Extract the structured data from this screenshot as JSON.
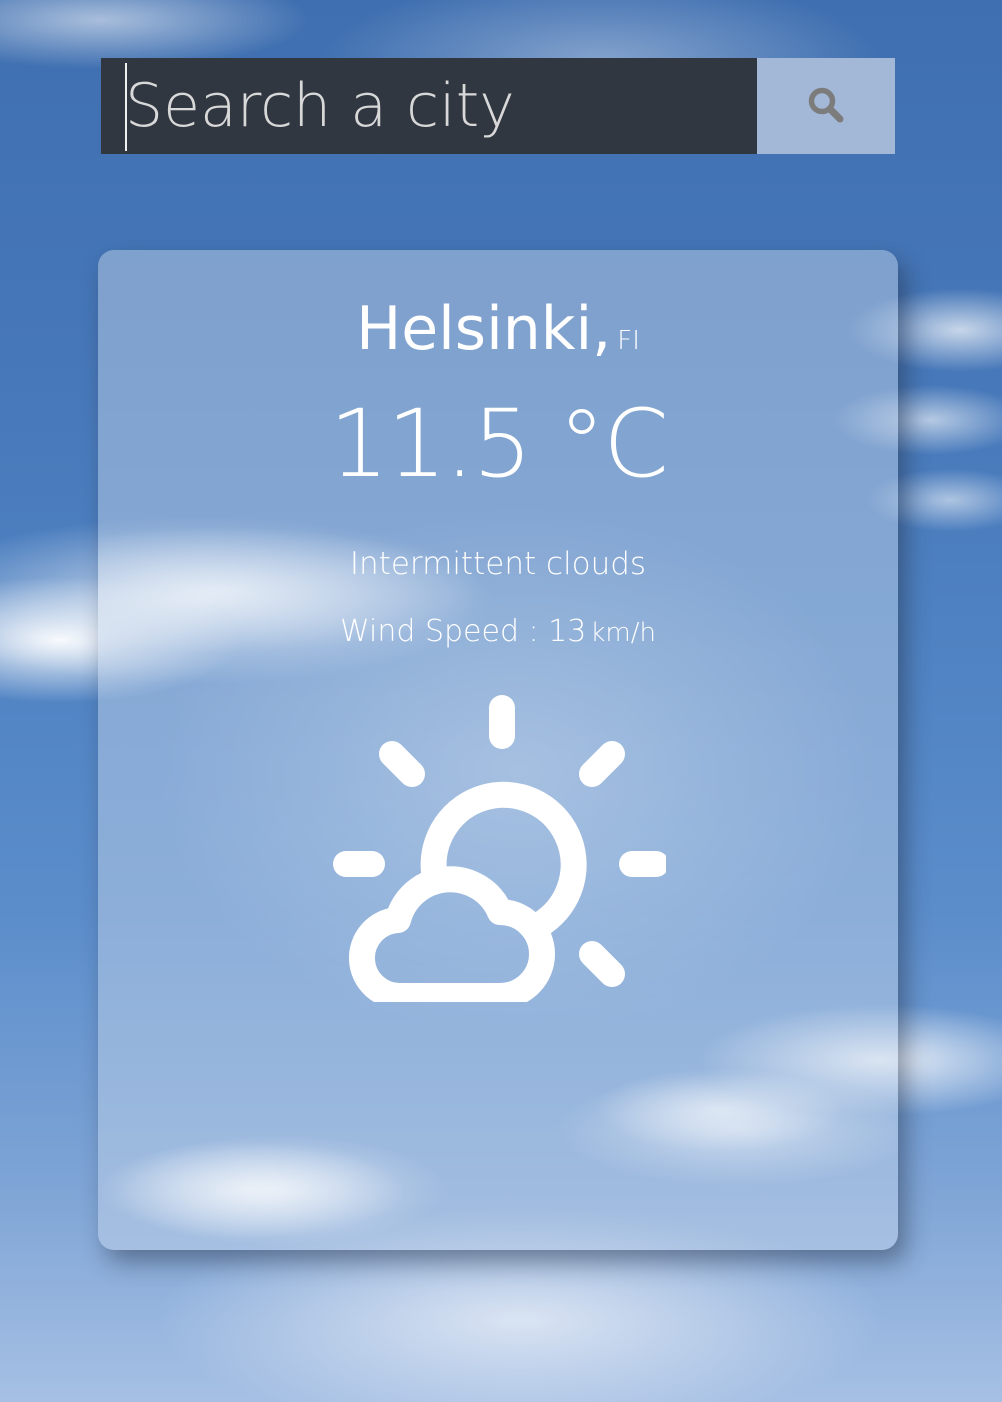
{
  "search": {
    "placeholder": "Search a city",
    "button_icon": "search-icon"
  },
  "weather": {
    "city": "Helsinki,",
    "country": "FI",
    "temperature": "11.5 °C",
    "description": "Intermittent clouds",
    "wind_label": "Wind Speed : 13",
    "wind_unit": "km/h",
    "icon": "partly-cloudy-day-icon"
  },
  "colors": {
    "search_bg": "#313741",
    "search_button_bg": "#a3b8d6",
    "text": "#ffffff"
  }
}
